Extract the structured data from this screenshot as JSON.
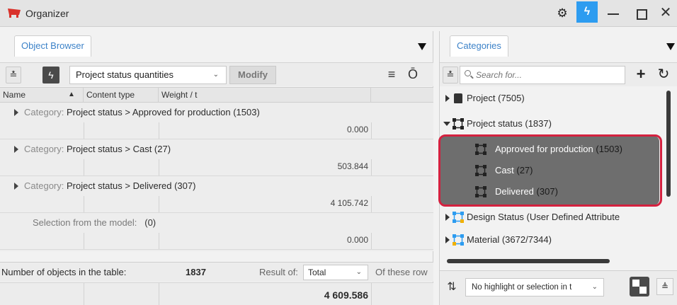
{
  "window": {
    "title": "Organizer",
    "logo_icon": "organizer-logo-icon",
    "controls": [
      "gear-icon",
      "lightning-icon",
      "minimize-icon",
      "maximize-icon",
      "close-icon"
    ],
    "accent": "#2d9cf0"
  },
  "object_browser": {
    "tab_label": "Object Browser",
    "toolbar": {
      "view_select": "Project status quantities",
      "modify_label": "Modify"
    },
    "columns": [
      "Name",
      "Content type",
      "Weight / t"
    ],
    "rows": [
      {
        "category_label": "Category:",
        "name": "Project status > Approved for production (1503)",
        "weight": "0.000"
      },
      {
        "category_label": "Category:",
        "name": "Project status > Cast (27)",
        "weight": "503.844"
      },
      {
        "category_label": "Category:",
        "name": "Project status > Delivered (307)",
        "weight": "4 105.742"
      }
    ],
    "selection_row": {
      "label": "Selection from the model:",
      "count": "(0)",
      "weight": "0.000"
    },
    "footer": {
      "objects_label": "Number of objects in the table:",
      "objects_count": "1837",
      "result_label": "Result of:",
      "result_select": "Total",
      "of_these_label": "Of these row",
      "total": "4 609.586"
    }
  },
  "categories": {
    "tab_label": "Categories",
    "search_placeholder": "Search for...",
    "tree": [
      {
        "label": "Project (7505)",
        "icon": "database-icon",
        "expanded": false
      },
      {
        "label": "Project status (1837)",
        "icon": "status-node-icon",
        "expanded": true,
        "children": [
          {
            "label": "Approved for production",
            "count": "(1503)"
          },
          {
            "label": "Cast",
            "count": "(27)"
          },
          {
            "label": "Delivered",
            "count": "(307)"
          }
        ]
      },
      {
        "label": "Design Status (User Defined Attribute",
        "icon": "color-node-icon",
        "expanded": false
      },
      {
        "label": "Material (3672/7344)",
        "icon": "color-node-icon",
        "expanded": false
      }
    ],
    "highlight_color": "#d4213f",
    "footer_select": "No highlight or selection in t"
  }
}
